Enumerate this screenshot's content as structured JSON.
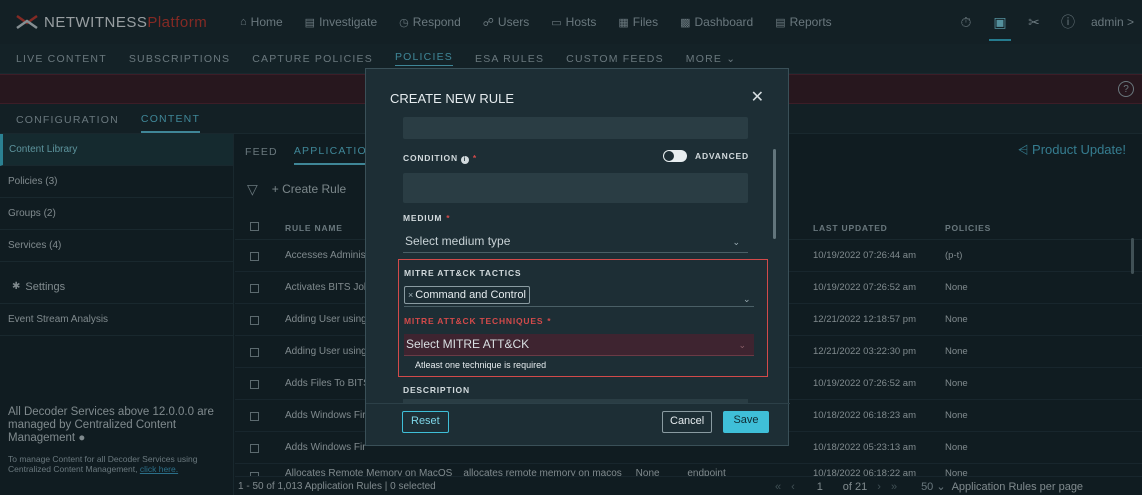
{
  "app": {
    "logo_main": "NETWITNESS",
    "logo_accent": "Platform",
    "nav": [
      {
        "icon": "⌂",
        "label": "Home"
      },
      {
        "icon": "▤",
        "label": "Investigate"
      },
      {
        "icon": "◷",
        "label": "Respond"
      },
      {
        "icon": "☍",
        "label": "Users"
      },
      {
        "icon": "▭",
        "label": "Hosts"
      },
      {
        "icon": "▦",
        "label": "Files"
      },
      {
        "icon": "▩",
        "label": "Dashboard"
      },
      {
        "icon": "▤",
        "label": "Reports"
      }
    ],
    "admin_label": "admin >"
  },
  "subnav": [
    "LIVE CONTENT",
    "SUBSCRIPTIONS",
    "CAPTURE POLICIES",
    "POLICIES",
    "ESA RULES",
    "CUSTOM FEEDS",
    "MORE ⌄"
  ],
  "config_tabs": [
    "CONFIGURATION",
    "CONTENT"
  ],
  "sidebar": {
    "items": [
      "Content Library",
      "Policies (3)",
      "Groups (2)",
      "Services (4)"
    ],
    "settings": "Settings",
    "event_stream": "Event Stream Analysis",
    "note": "All Decoder Services above 12.0.0.0 are managed by Centralized Content Management",
    "sub": "To manage Content for all Decoder Services using Centralized Content Management,",
    "sub_link": "click here."
  },
  "main": {
    "tabs": [
      "FEED",
      "APPLICATIO"
    ],
    "product_update": "Product Update!",
    "create_rule": "Create Rule",
    "columns": {
      "name": "RULE NAME",
      "updated": "LAST UPDATED",
      "policies": "POLICIES"
    },
    "rows": [
      {
        "name": "Accesses Administ",
        "updated": "10/19/2022 07:26:44 am",
        "policies": "(p-t)"
      },
      {
        "name": "Activates BITS Job",
        "updated": "10/19/2022 07:26:52 am",
        "policies": "None"
      },
      {
        "name": "Adding User using",
        "updated": "12/21/2022 12:18:57 pm",
        "policies": "None"
      },
      {
        "name": "Adding User using",
        "updated": "12/21/2022 03:22:30 pm",
        "policies": "None"
      },
      {
        "name": "Adds Files To BITS",
        "updated": "10/19/2022 07:26:52 am",
        "policies": "None"
      },
      {
        "name": "Adds Windows Fir",
        "updated": "10/18/2022 06:18:23 am",
        "policies": "None"
      },
      {
        "name": "Adds Windows Fir",
        "updated": "10/18/2022 05:23:13 am",
        "policies": "None"
      },
      {
        "name": "Allocates Remote Memory on MacOS    allocates remote memory on macos     None          endpoint",
        "updated": "10/18/2022 06:18:22 am",
        "policies": "None"
      }
    ],
    "footer_count": "1 - 50 of 1,013 Application Rules | 0 selected",
    "page_current": "1",
    "page_of": "of 21",
    "per_page": "50 ⌄",
    "per_page_label": "Application Rules per page"
  },
  "modal": {
    "title": "CREATE NEW RULE",
    "condition_label": "CONDITION",
    "advanced_label": "ADVANCED",
    "medium_label": "MEDIUM",
    "medium_placeholder": "Select medium type",
    "tactics_label": "MITRE ATT&CK TACTICS",
    "tactic_tag": "Command and Control",
    "techniques_label": "MITRE ATT&CK TECHNIQUES",
    "techniques_placeholder": "Select MITRE ATT&CK",
    "techniques_error": "Atleast one technique is required",
    "description_label": "DESCRIPTION",
    "reset": "Reset",
    "cancel": "Cancel",
    "save": "Save"
  },
  "colors": {
    "accent": "#3fbfd8",
    "error": "#d24a4a",
    "brand_red": "#c8392f"
  }
}
